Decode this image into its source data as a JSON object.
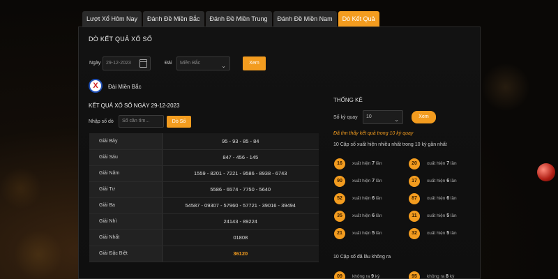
{
  "tabs": [
    {
      "label": "Lượt Xổ Hôm Nay"
    },
    {
      "label": "Đánh Đề Miền Bắc"
    },
    {
      "label": "Đánh Đề Miền Trung"
    },
    {
      "label": "Đánh Đề Miền Nam"
    },
    {
      "label": "Dò Kết Quả",
      "active": true
    }
  ],
  "panel": {
    "title": "DÒ KẾT QUẢ XỔ SỐ",
    "date_label": "Ngày",
    "date_value": "29-12-2023",
    "station_label": "Đài",
    "station_value": "Miền Bắc",
    "view_button": "Xem",
    "logo_letter": "X",
    "region_name": "Đài Miền Bắc",
    "result_title": "KẾT QUẢ XỔ SỐ NGÀY 29-12-2023",
    "ticket_label": "Nhập số dò",
    "ticket_placeholder": "Số cần tìm...",
    "check_button": "Dò Số"
  },
  "results": [
    {
      "name": "Giải Bảy",
      "value": "95 - 93 - 85 - 84"
    },
    {
      "name": "Giải Sáu",
      "value": "847 - 456 - 145"
    },
    {
      "name": "Giải Năm",
      "value": "1559 - 8201 - 7221 - 9586 - 8938 - 6743"
    },
    {
      "name": "Giải Tư",
      "value": "5586 - 6574 - 7750 - 5640"
    },
    {
      "name": "Giải Ba",
      "value": "54587 - 09307 - 57960 - 57721 - 39016 - 39494"
    },
    {
      "name": "Giải Nhì",
      "value": "24143 - 89224"
    },
    {
      "name": "Giải Nhất",
      "value": "01808"
    },
    {
      "name": "Giải Đặc Biệt",
      "value": "36120",
      "special": true
    }
  ],
  "stats": {
    "title": "THỐNG KÊ",
    "rounds_label": "Số kỳ quay",
    "rounds_value": "10",
    "view_button": "Xem",
    "found_note": "Đã tìm thấy kết quả trong 10 kỳ quay",
    "most_heading": "10 Cặp số xuất hiện nhiều nhất trong 10 kỳ gần nhất",
    "most": [
      {
        "num": "16",
        "prefix": "xuất hiện",
        "count": "7",
        "suffix": "lần"
      },
      {
        "num": "20",
        "prefix": "xuất hiện",
        "count": "7",
        "suffix": "lần"
      },
      {
        "num": "90",
        "prefix": "xuất hiện",
        "count": "7",
        "suffix": "lần"
      },
      {
        "num": "17",
        "prefix": "xuất hiện",
        "count": "6",
        "suffix": "lần"
      },
      {
        "num": "52",
        "prefix": "xuất hiện",
        "count": "6",
        "suffix": "lần"
      },
      {
        "num": "87",
        "prefix": "xuất hiện",
        "count": "6",
        "suffix": "lần"
      },
      {
        "num": "35",
        "prefix": "xuất hiện",
        "count": "6",
        "suffix": "lần"
      },
      {
        "num": "11",
        "prefix": "xuất hiện",
        "count": "5",
        "suffix": "lần"
      },
      {
        "num": "21",
        "prefix": "xuất hiện",
        "count": "5",
        "suffix": "lần"
      },
      {
        "num": "32",
        "prefix": "xuất hiện",
        "count": "5",
        "suffix": "lần"
      }
    ],
    "least_heading": "10 Cặp số đã lâu không ra",
    "least": [
      {
        "num": "09",
        "prefix": "không ra",
        "count": "9",
        "suffix": "kỳ"
      },
      {
        "num": "95",
        "prefix": "không ra",
        "count": "8",
        "suffix": "kỳ"
      }
    ]
  },
  "colors": {
    "accent": "#f39c1f",
    "panel_bg": "#121212"
  }
}
